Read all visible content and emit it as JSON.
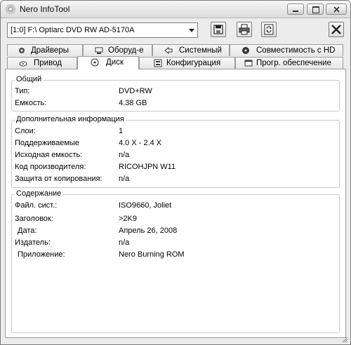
{
  "window": {
    "title": "Nero InfoTool"
  },
  "toolbar": {
    "drive_selected": "[1:0]  F:\\ Optiarc  DVD RW AD-5170A"
  },
  "tabs_top": [
    {
      "label": "Драйверы",
      "icon": "gear-icon"
    },
    {
      "label": "Оборуд-е",
      "icon": "hardware-icon"
    },
    {
      "label": "Системный",
      "icon": "system-icon"
    },
    {
      "label": "Совместимость с HD",
      "icon": "hd-icon"
    }
  ],
  "tabs_bottom": [
    {
      "label": "Привод",
      "icon": "drive-icon"
    },
    {
      "label": "Диск",
      "icon": "disc-icon",
      "active": true
    },
    {
      "label": "Конфигурация",
      "icon": "config-icon"
    },
    {
      "label": "Прогр. обеспечение",
      "icon": "software-icon"
    }
  ],
  "general": {
    "title": "Общий",
    "rows": [
      {
        "key": "Тип:",
        "value": "DVD+RW"
      },
      {
        "key": "Емкость:",
        "value": "4.38 GB"
      }
    ]
  },
  "additional": {
    "title": "Дополнительная информация",
    "rows": [
      {
        "key": "Слои:",
        "value": "1"
      },
      {
        "key": "Поддерживаемые",
        "value": "4.0 X - 2.4 X"
      },
      {
        "key": "Исходная емкость:",
        "value": "n/a"
      },
      {
        "key": "Код производителя:",
        "value": "RICOHJPN W11"
      },
      {
        "key": "Защита от копирования:",
        "value": "n/a"
      }
    ]
  },
  "content": {
    "title": "Содержание",
    "rows": [
      {
        "key": "Файл. сист.:",
        "value": "ISO9660, Joliet"
      },
      {
        "key": "Заголовок:",
        "value": ">2K9"
      },
      {
        "key": "Дата:",
        "value": "Апрель 26, 2008"
      },
      {
        "key": "Издатель:",
        "value": "n/a"
      },
      {
        "key": "Приложение:",
        "value": "Nero Burning ROM"
      }
    ]
  }
}
